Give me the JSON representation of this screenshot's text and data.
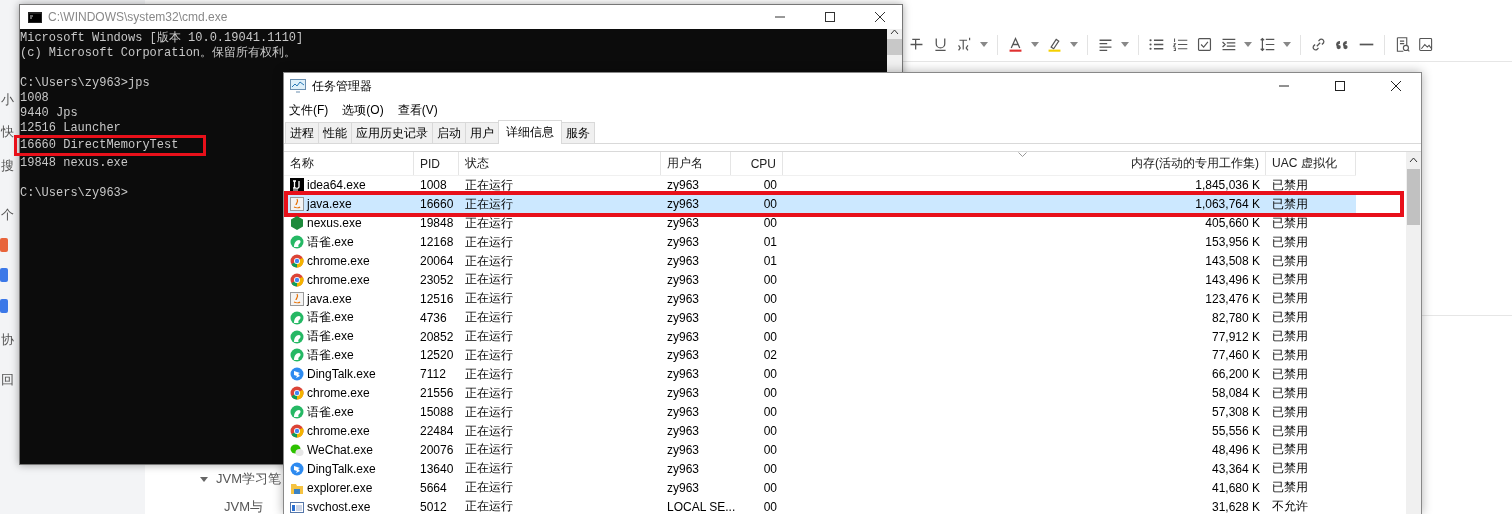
{
  "background_app": {
    "sidebar_fragments": [
      "小",
      "快",
      "搜",
      "个",
      "协",
      "回"
    ],
    "tree_items": [
      {
        "label": "JVM学习笔",
        "expanded": true
      },
      {
        "label": "JVM与",
        "expanded": false
      }
    ]
  },
  "cmd_window": {
    "title": "C:\\WINDOWS\\system32\\cmd.exe",
    "blocks": [
      [
        {
          "text": "Microsoft Windows [版本 10.0.19041.1110]",
          "highlighted": false
        },
        {
          "text": "(c) Microsoft Corporation。保留所有权利。",
          "highlighted": false
        }
      ],
      [
        {
          "text": "C:\\Users\\zy963>jps",
          "highlighted": false
        },
        {
          "text": "1008",
          "highlighted": false
        },
        {
          "text": "9440 Jps",
          "highlighted": false
        },
        {
          "text": "12516 Launcher",
          "highlighted": false
        },
        {
          "text": "16660 DirectMemoryTest",
          "highlighted": true
        },
        {
          "text": "19848 nexus.exe",
          "highlighted": false
        }
      ],
      [
        {
          "text": "C:\\Users\\zy963>",
          "highlighted": false
        }
      ]
    ]
  },
  "task_manager": {
    "title": "任务管理器",
    "menu": [
      "文件(F)",
      "选项(O)",
      "查看(V)"
    ],
    "tabs": [
      {
        "label": "进程",
        "selected": false
      },
      {
        "label": "性能",
        "selected": false
      },
      {
        "label": "应用历史记录",
        "selected": false
      },
      {
        "label": "启动",
        "selected": false
      },
      {
        "label": "用户",
        "selected": false
      },
      {
        "label": "详细信息",
        "selected": true
      },
      {
        "label": "服务",
        "selected": false
      }
    ],
    "table": {
      "columns": [
        "名称",
        "PID",
        "状态",
        "用户名",
        "CPU",
        "内存(活动的专用工作集)",
        "UAC 虚拟化"
      ],
      "rows": [
        {
          "kind": "idea",
          "cells": [
            "idea64.exe",
            "1008",
            "正在运行",
            "zy963",
            "00",
            "1,845,036 K",
            "已禁用"
          ],
          "selected": false
        },
        {
          "kind": "java",
          "cells": [
            "java.exe",
            "16660",
            "正在运行",
            "zy963",
            "00",
            "1,063,764 K",
            "已禁用"
          ],
          "selected": true
        },
        {
          "kind": "hex",
          "cells": [
            "nexus.exe",
            "19848",
            "正在运行",
            "zy963",
            "00",
            "405,660 K",
            "已禁用"
          ],
          "selected": false
        },
        {
          "kind": "yuque",
          "cells": [
            "语雀.exe",
            "12168",
            "正在运行",
            "zy963",
            "01",
            "153,956 K",
            "已禁用"
          ],
          "selected": false
        },
        {
          "kind": "chrome",
          "cells": [
            "chrome.exe",
            "20064",
            "正在运行",
            "zy963",
            "01",
            "143,508 K",
            "已禁用"
          ],
          "selected": false
        },
        {
          "kind": "chrome",
          "cells": [
            "chrome.exe",
            "23052",
            "正在运行",
            "zy963",
            "00",
            "143,496 K",
            "已禁用"
          ],
          "selected": false
        },
        {
          "kind": "java",
          "cells": [
            "java.exe",
            "12516",
            "正在运行",
            "zy963",
            "00",
            "123,476 K",
            "已禁用"
          ],
          "selected": false
        },
        {
          "kind": "yuque",
          "cells": [
            "语雀.exe",
            "4736",
            "正在运行",
            "zy963",
            "00",
            "82,780 K",
            "已禁用"
          ],
          "selected": false
        },
        {
          "kind": "yuque",
          "cells": [
            "语雀.exe",
            "20852",
            "正在运行",
            "zy963",
            "00",
            "77,912 K",
            "已禁用"
          ],
          "selected": false
        },
        {
          "kind": "yuque",
          "cells": [
            "语雀.exe",
            "12520",
            "正在运行",
            "zy963",
            "02",
            "77,460 K",
            "已禁用"
          ],
          "selected": false
        },
        {
          "kind": "dingtalk",
          "cells": [
            "DingTalk.exe",
            "7112",
            "正在运行",
            "zy963",
            "00",
            "66,200 K",
            "已禁用"
          ],
          "selected": false
        },
        {
          "kind": "chrome",
          "cells": [
            "chrome.exe",
            "21556",
            "正在运行",
            "zy963",
            "00",
            "58,084 K",
            "已禁用"
          ],
          "selected": false
        },
        {
          "kind": "yuque",
          "cells": [
            "语雀.exe",
            "15088",
            "正在运行",
            "zy963",
            "00",
            "57,308 K",
            "已禁用"
          ],
          "selected": false
        },
        {
          "kind": "chrome",
          "cells": [
            "chrome.exe",
            "22484",
            "正在运行",
            "zy963",
            "00",
            "55,556 K",
            "已禁用"
          ],
          "selected": false
        },
        {
          "kind": "wechat",
          "cells": [
            "WeChat.exe",
            "20076",
            "正在运行",
            "zy963",
            "00",
            "48,496 K",
            "已禁用"
          ],
          "selected": false
        },
        {
          "kind": "dingtalk",
          "cells": [
            "DingTalk.exe",
            "13640",
            "正在运行",
            "zy963",
            "00",
            "43,364 K",
            "已禁用"
          ],
          "selected": false
        },
        {
          "kind": "folder",
          "cells": [
            "explorer.exe",
            "5664",
            "正在运行",
            "zy963",
            "00",
            "41,680 K",
            "已禁用"
          ],
          "selected": false
        },
        {
          "kind": "service",
          "cells": [
            "svchost.exe",
            "5012",
            "正在运行",
            "LOCAL SE...",
            "00",
            "31,628 K",
            "不允许"
          ],
          "selected": false
        }
      ]
    }
  }
}
